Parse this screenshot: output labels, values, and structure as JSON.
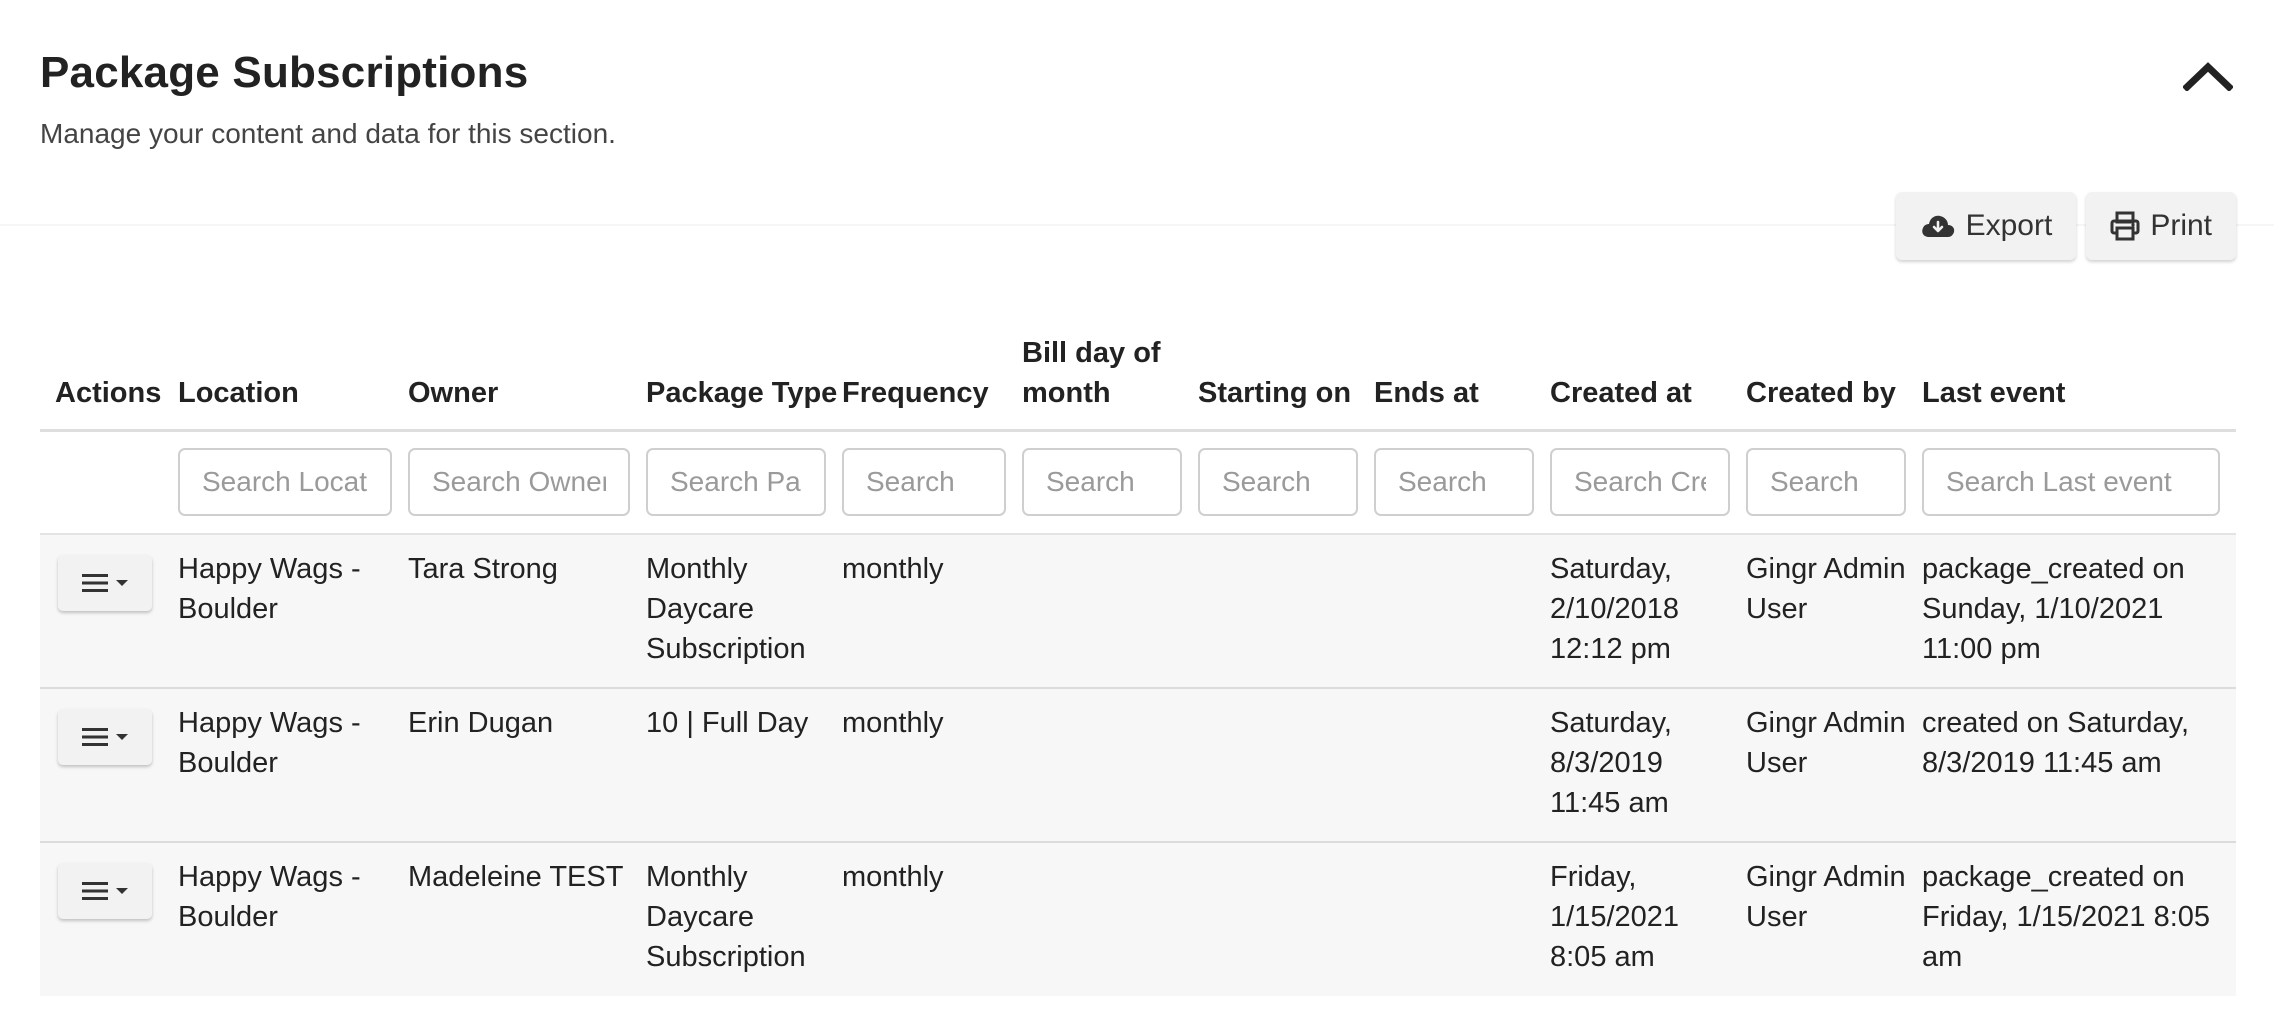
{
  "section": {
    "title": "Package Subscriptions",
    "subtitle": "Manage your content and data for this section.",
    "collapse_icon": "chevron-up-icon"
  },
  "toolbar": {
    "export_label": "Export",
    "export_icon": "cloud-download-icon",
    "print_label": "Print",
    "print_icon": "printer-icon"
  },
  "table": {
    "columns": [
      {
        "key": "actions",
        "label": "Actions"
      },
      {
        "key": "location",
        "label": "Location"
      },
      {
        "key": "owner",
        "label": "Owner"
      },
      {
        "key": "package_type",
        "label": "Package Type"
      },
      {
        "key": "frequency",
        "label": "Frequency"
      },
      {
        "key": "bill_day",
        "label": "Bill day of month"
      },
      {
        "key": "starting_on",
        "label": "Starting on"
      },
      {
        "key": "ends_at",
        "label": "Ends at"
      },
      {
        "key": "created_at",
        "label": "Created at"
      },
      {
        "key": "created_by",
        "label": "Created by"
      },
      {
        "key": "last_event",
        "label": "Last event"
      }
    ],
    "filters": {
      "location": "Search Location",
      "owner": "Search Owner",
      "package_type": "Search Package Type",
      "frequency": "Search",
      "bill_day": "Search",
      "starting_on": "Search",
      "ends_at": "Search",
      "created_at": "Search Created at",
      "created_by": "Search",
      "last_event": "Search Last event"
    },
    "rows": [
      {
        "location": "Happy Wags - Boulder",
        "owner": "Tara Strong",
        "package_type": "Monthly Daycare Subscription",
        "frequency": "monthly",
        "bill_day": "",
        "starting_on": "",
        "ends_at": "",
        "created_at": "Saturday, 2/10/2018 12:12 pm",
        "created_by": "Gingr Admin User",
        "last_event": "package_created on Sunday, 1/10/2021 11:00 pm"
      },
      {
        "location": "Happy Wags - Boulder",
        "owner": "Erin Dugan",
        "package_type": "10 | Full Day",
        "frequency": "monthly",
        "bill_day": "",
        "starting_on": "",
        "ends_at": "",
        "created_at": "Saturday, 8/3/2019 11:45 am",
        "created_by": "Gingr Admin User",
        "last_event": "created on Saturday, 8/3/2019 11:45 am"
      },
      {
        "location": "Happy Wags - Boulder",
        "owner": "Madeleine TEST",
        "package_type": "Monthly Daycare Subscription",
        "frequency": "monthly",
        "bill_day": "",
        "starting_on": "",
        "ends_at": "",
        "created_at": "Friday, 1/15/2021 8:05 am",
        "created_by": "Gingr Admin User",
        "last_event": "package_created on Friday, 1/15/2021 8:05 am"
      }
    ],
    "row_action_icon": "hamburger-menu-icon"
  },
  "colors": {
    "row_background": "#f7f7f7",
    "button_background": "#f2f2f2",
    "text": "#222222"
  }
}
